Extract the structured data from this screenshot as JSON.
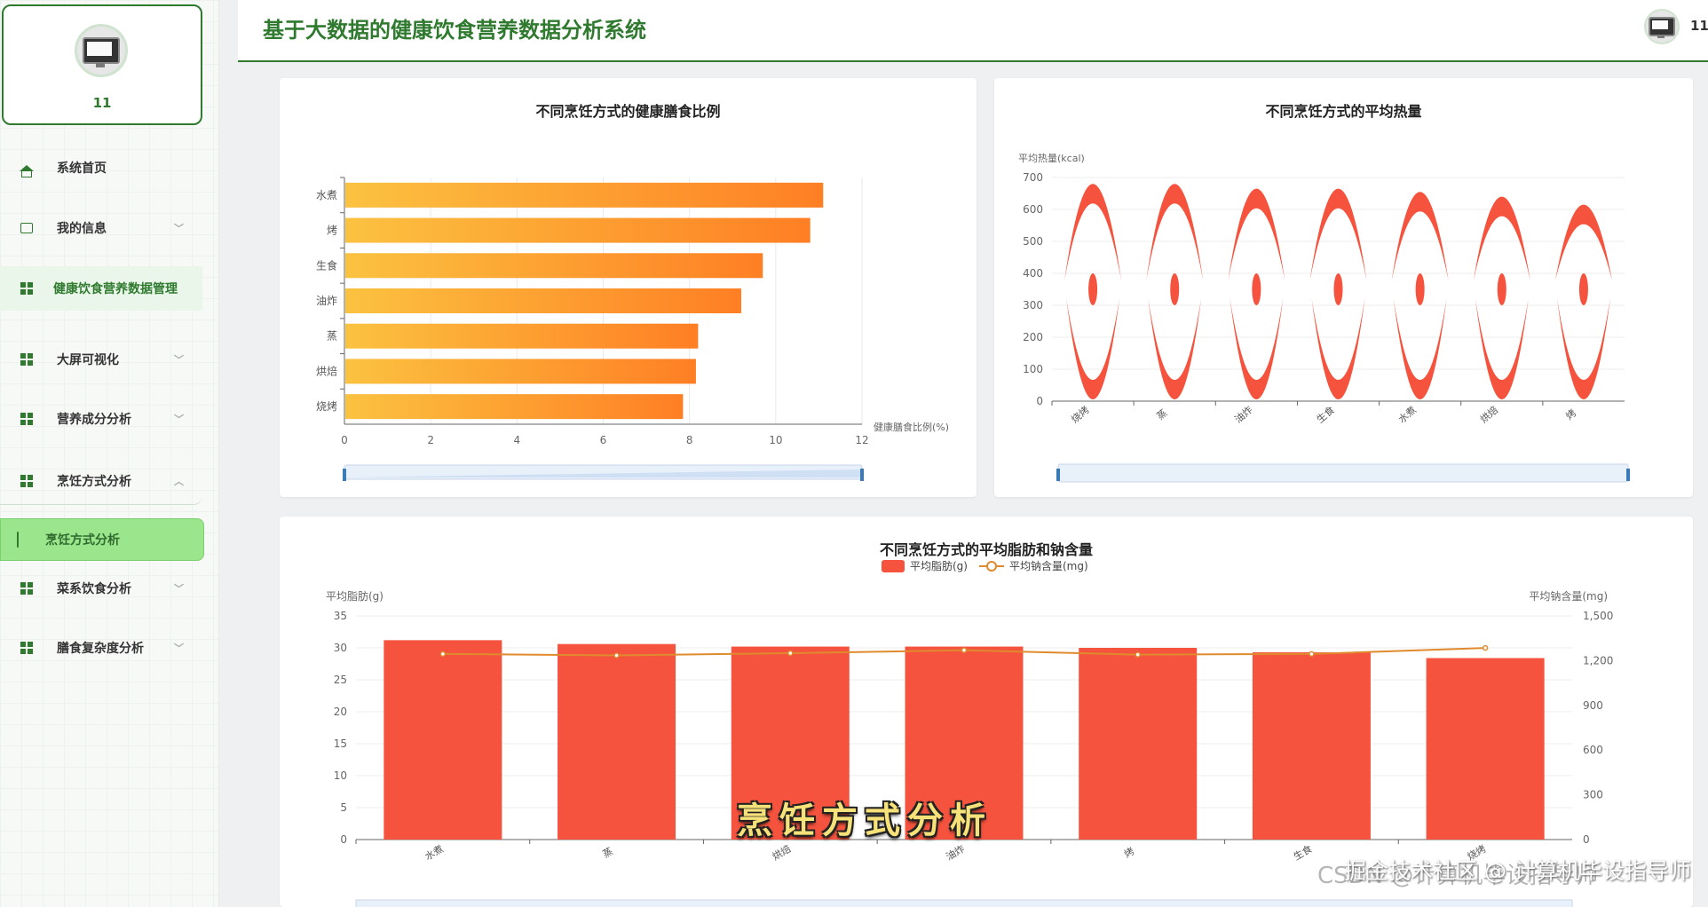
{
  "app": {
    "title": "基于大数据的健康饮食营养数据分析系统",
    "username": "11"
  },
  "sidebar": {
    "username": "11",
    "items": [
      {
        "label": "系统首页",
        "icon": "home-icon"
      },
      {
        "label": "我的信息",
        "icon": "id-card-icon",
        "expandable": true
      },
      {
        "label": "健康饮食营养数据管理",
        "icon": "grid-icon",
        "active": true
      },
      {
        "label": "大屏可视化",
        "icon": "grid-icon",
        "expandable": true
      },
      {
        "label": "营养成分分析",
        "icon": "grid-icon",
        "expandable": true
      },
      {
        "label": "烹饪方式分析",
        "icon": "grid-icon",
        "expanded": true
      },
      {
        "label": "菜系饮食分析",
        "icon": "grid-icon",
        "expandable": true
      },
      {
        "label": "膳食复杂度分析",
        "icon": "grid-icon",
        "expandable": true
      }
    ],
    "submenu_active": {
      "label": "烹饪方式分析",
      "icon": "document-icon"
    }
  },
  "colors": {
    "brand": "#2f7a2f",
    "accent": "#9be68c",
    "bar_red": "#f5533d",
    "line_orange": "#e08a2e",
    "gradient_from": "#fbc240",
    "gradient_to": "#ff7f24"
  },
  "chart_data": [
    {
      "type": "bar",
      "orientation": "horizontal",
      "title": "不同烹饪方式的健康膳食比例",
      "categories": [
        "水煮",
        "烤",
        "生食",
        "油炸",
        "蒸",
        "烘焙",
        "烧烤"
      ],
      "values": [
        11.1,
        10.8,
        9.7,
        9.2,
        8.2,
        8.15,
        7.85
      ],
      "xlabel": "健康膳食比例(%)",
      "xlim": [
        0,
        12
      ],
      "xticks": [
        "0",
        "2",
        "4",
        "6",
        "8",
        "10",
        "12"
      ],
      "grid": true
    },
    {
      "type": "pictorial-bar",
      "title": "不同烹饪方式的平均热量",
      "categories": [
        "烧烤",
        "蒸",
        "油炸",
        "生食",
        "水煮",
        "烘焙",
        "烤"
      ],
      "values": [
        680,
        680,
        665,
        665,
        655,
        640,
        615
      ],
      "ylabel": "平均热量(kcal)",
      "ylim": [
        0,
        700
      ],
      "yticks": [
        "0",
        "100",
        "200",
        "300",
        "400",
        "500",
        "600",
        "700"
      ],
      "grid": true
    },
    {
      "type": "bar+line",
      "title": "不同烹饪方式的平均脂肪和钠含量",
      "categories": [
        "水煮",
        "蒸",
        "烘焙",
        "油炸",
        "烤",
        "生食",
        "烧烤"
      ],
      "series": [
        {
          "name": "平均脂肪(g)",
          "type": "bar",
          "axis": "left",
          "values": [
            31.2,
            30.6,
            30.2,
            30.2,
            30.0,
            29.3,
            28.4
          ]
        },
        {
          "name": "平均钠含量(mg)",
          "type": "line",
          "axis": "right",
          "values": [
            1245,
            1235,
            1250,
            1270,
            1240,
            1245,
            1285
          ]
        }
      ],
      "ylabel_left": "平均脂肪(g)",
      "ylabel_right": "平均钠含量(mg)",
      "ylim_left": [
        0,
        35
      ],
      "ylim_right": [
        0,
        1500
      ],
      "yticks_left": [
        "0",
        "5",
        "10",
        "15",
        "20",
        "25",
        "30",
        "35"
      ],
      "yticks_right": [
        "0",
        "300",
        "600",
        "900",
        "1,200",
        "1,500"
      ],
      "legend": "top-center",
      "grid": true
    }
  ],
  "overlay": {
    "caption": "烹饪方式分析",
    "watermark_back": "CSDN @计算机毕设指导师",
    "watermark_front": "掘金技术社区 @ 计算机毕设指导师"
  }
}
